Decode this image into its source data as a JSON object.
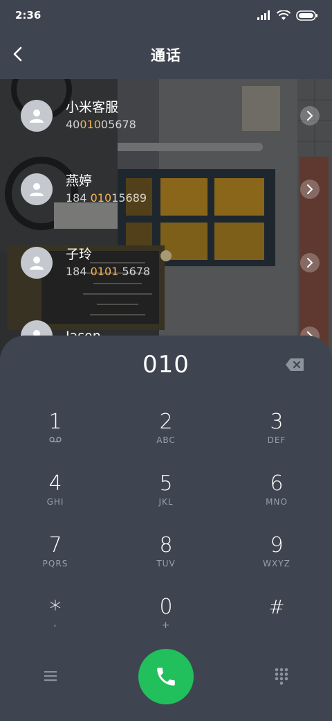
{
  "status_bar": {
    "time": "2:36"
  },
  "header": {
    "title": "通话"
  },
  "contacts": [
    {
      "name": "小米客服",
      "number_parts": [
        "40",
        "010",
        "05678"
      ]
    },
    {
      "name": "燕婷",
      "number_parts": [
        "184 ",
        "010",
        "15689"
      ]
    },
    {
      "name": "子玲",
      "number_parts": [
        "184 ",
        "0101",
        " 5678"
      ]
    },
    {
      "name": "Jason",
      "number_parts": [
        "",
        "",
        ""
      ]
    }
  ],
  "dialer": {
    "dialed_number": "010",
    "keys": [
      {
        "digit": "1",
        "sub": ""
      },
      {
        "digit": "2",
        "sub": "ABC"
      },
      {
        "digit": "3",
        "sub": "DEF"
      },
      {
        "digit": "4",
        "sub": "GHI"
      },
      {
        "digit": "5",
        "sub": "JKL"
      },
      {
        "digit": "6",
        "sub": "MNO"
      },
      {
        "digit": "7",
        "sub": "PQRS"
      },
      {
        "digit": "8",
        "sub": "TUV"
      },
      {
        "digit": "9",
        "sub": "WXYZ"
      },
      {
        "digit": "*",
        "sub": ","
      },
      {
        "digit": "0",
        "sub": "+"
      },
      {
        "digit": "#",
        "sub": ""
      }
    ]
  },
  "colors": {
    "highlight": "#f3b35a",
    "call_button": "#21c05d",
    "panel": "#3f4550"
  },
  "icons": [
    "back-icon",
    "signal-icon",
    "wifi-icon",
    "battery-icon",
    "person-icon",
    "chevron-right-icon",
    "backspace-icon",
    "voicemail-icon",
    "menu-icon",
    "phone-icon",
    "dialpad-icon"
  ]
}
